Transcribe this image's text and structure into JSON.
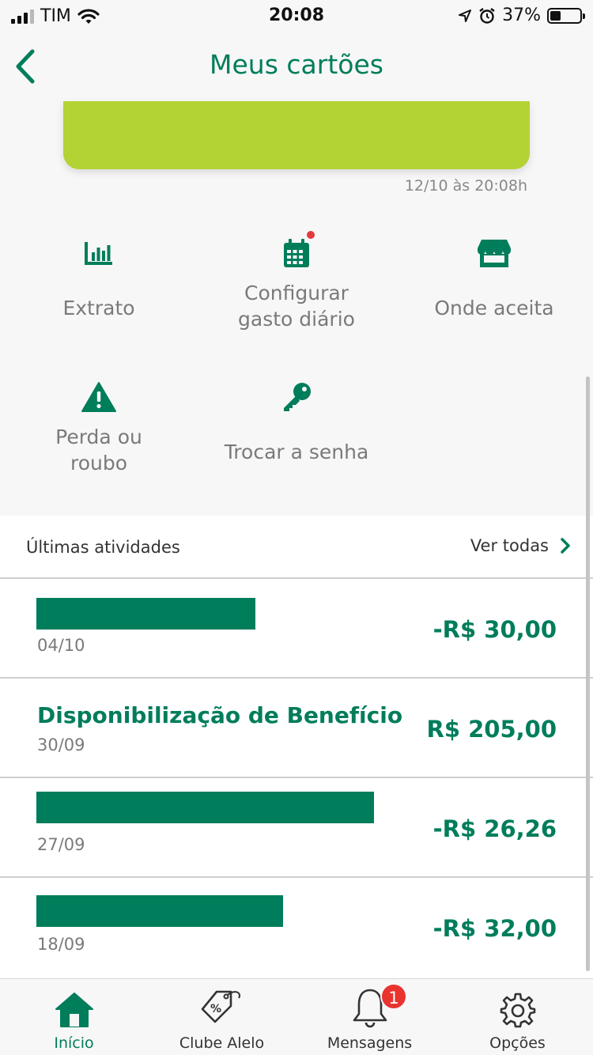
{
  "status_bar": {
    "carrier": "TIM",
    "time": "20:08",
    "battery": "37%",
    "battery_level": 0.37
  },
  "header": {
    "title": "Meus cartões",
    "back_icon": "chevron-left-icon"
  },
  "card": {
    "timestamp": "12/10 às 20:08h"
  },
  "actions": [
    {
      "label": "Extrato",
      "icon": "bar-chart-icon"
    },
    {
      "label": "Configurar gasto diário",
      "icon": "calendar-icon",
      "has_dot": true
    },
    {
      "label": "Onde aceita",
      "icon": "store-icon"
    },
    {
      "label": "Perda ou roubo",
      "icon": "warning-icon"
    },
    {
      "label": "Trocar a senha",
      "icon": "key-icon"
    }
  ],
  "activities": {
    "title": "Últimas atividades",
    "see_all": "Ver todas",
    "items": [
      {
        "description": "",
        "date": "04/10",
        "amount": "-R$ 30,00"
      },
      {
        "description": "Disponibilização de Benefício",
        "date": "30/09",
        "amount": "R$ 205,00"
      },
      {
        "description": "",
        "date": "27/09",
        "amount": "-R$ 26,26"
      },
      {
        "description": "",
        "date": "18/09",
        "amount": "-R$ 32,00"
      }
    ]
  },
  "tabbar": {
    "tabs": [
      {
        "label": "Início",
        "icon": "home-icon",
        "active": true
      },
      {
        "label": "Clube Alelo",
        "icon": "discount-tag-icon"
      },
      {
        "label": "Mensagens",
        "icon": "bell-icon",
        "badge": "1"
      },
      {
        "label": "Opções",
        "icon": "gear-icon"
      }
    ]
  },
  "colors": {
    "brand_green": "#007d5b",
    "card_green": "#b3d233",
    "badge_red": "#e8332f"
  }
}
